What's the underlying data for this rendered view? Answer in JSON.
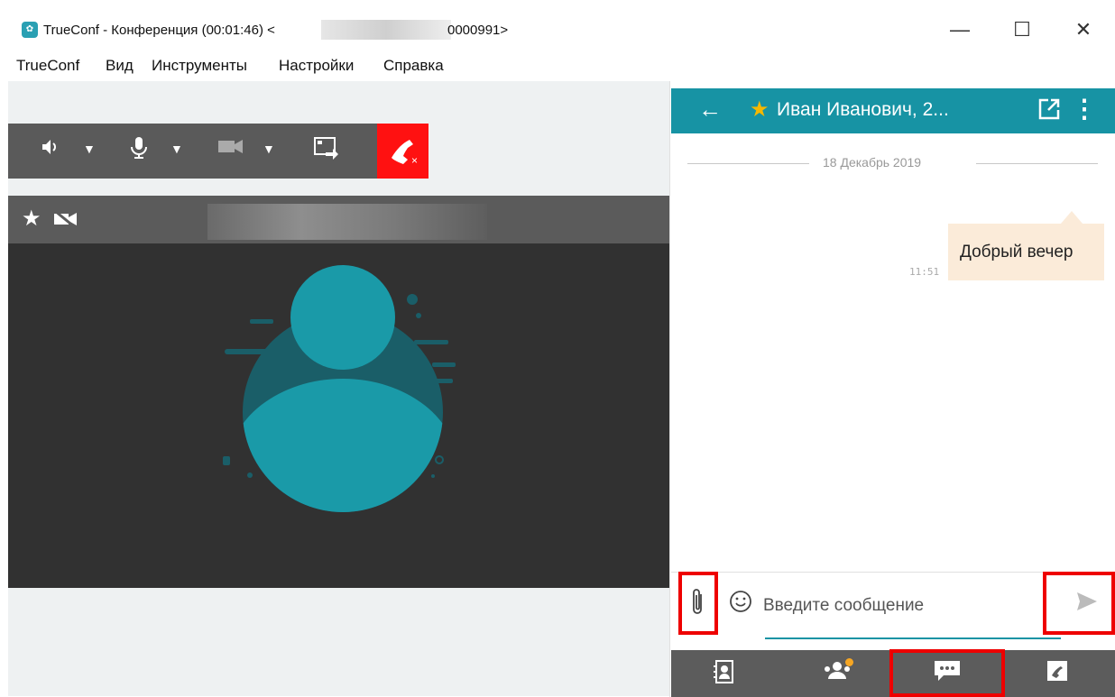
{
  "window": {
    "title": "TrueConf - Конференция (00:01:46) <",
    "title_suffix": "0000991>",
    "minimize_glyph": "—",
    "maximize_glyph": "☐",
    "close_glyph": "✕"
  },
  "menu": {
    "items": [
      "TrueConf",
      "Вид",
      "Инструменты",
      "Настройки",
      "Справка"
    ]
  },
  "toolbar": {
    "speaker_icon": "speaker-icon",
    "mic_icon": "microphone-icon",
    "camera_icon": "camera-icon",
    "share_icon": "screen-share-icon",
    "hangup_icon": "hangup-icon",
    "hangup_color": "#ff1a1a"
  },
  "video": {
    "header_icons": [
      "star-icon",
      "camera-off-icon"
    ],
    "avatar_color": "#1a9aa8",
    "background_color": "#313131"
  },
  "chat": {
    "contact_name": "Иван Иванович, 2...",
    "header_color": "#1793a4",
    "date_separator": "18 Декабрь 2019",
    "messages": [
      {
        "text": "Добрый вечер",
        "time": "11:51"
      }
    ],
    "input_placeholder": "Введите сообщение"
  },
  "bottom_nav": {
    "items": [
      "contacts-icon",
      "conference-icon",
      "chat-icon",
      "call-history-icon"
    ],
    "active": "chat-icon",
    "badge_color": "#f6a623"
  }
}
